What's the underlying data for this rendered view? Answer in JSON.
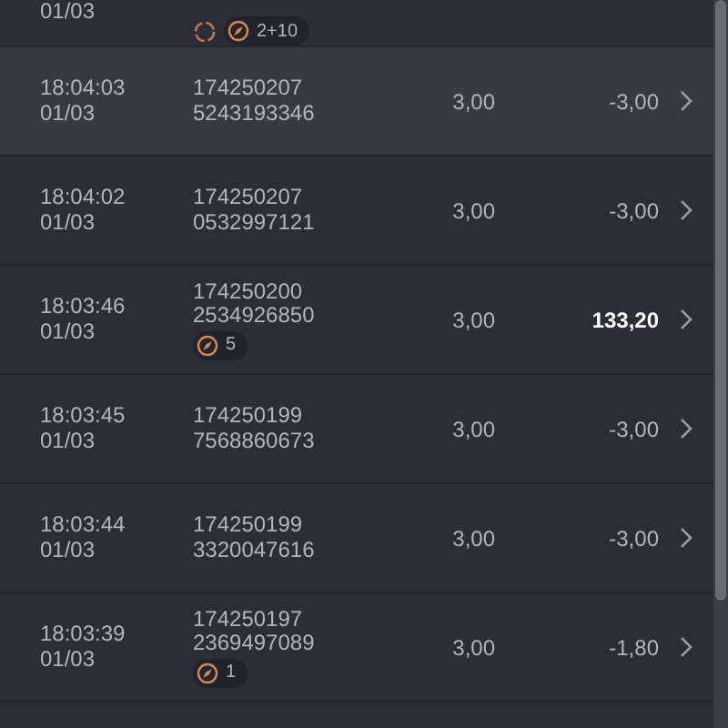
{
  "top_row": {
    "date": "01/03",
    "badges": [
      {
        "kind": "spin"
      },
      {
        "kind": "bonus",
        "text": "2+10"
      }
    ]
  },
  "rows": [
    {
      "time": "18:04:03",
      "date": "01/03",
      "id_1": "174250207",
      "id_2": "5243193346",
      "stake": "3,00",
      "result": "-3,00",
      "won": false,
      "selected": true,
      "badges": []
    },
    {
      "time": "18:04:02",
      "date": "01/03",
      "id_1": "174250207",
      "id_2": "0532997121",
      "stake": "3,00",
      "result": "-3,00",
      "won": false,
      "selected": false,
      "badges": []
    },
    {
      "time": "18:03:46",
      "date": "01/03",
      "id_1": "174250200",
      "id_2": "2534926850",
      "stake": "3,00",
      "result": "133,20",
      "won": true,
      "selected": false,
      "badges": [
        {
          "kind": "bonus",
          "text": "5"
        }
      ]
    },
    {
      "time": "18:03:45",
      "date": "01/03",
      "id_1": "174250199",
      "id_2": "7568860673",
      "stake": "3,00",
      "result": "-3,00",
      "won": false,
      "selected": false,
      "badges": []
    },
    {
      "time": "18:03:44",
      "date": "01/03",
      "id_1": "174250199",
      "id_2": "3320047616",
      "stake": "3,00",
      "result": "-3,00",
      "won": false,
      "selected": false,
      "badges": []
    },
    {
      "time": "18:03:39",
      "date": "01/03",
      "id_1": "174250197",
      "id_2": "2369497089",
      "stake": "3,00",
      "result": "-1,80",
      "won": false,
      "selected": false,
      "badges": [
        {
          "kind": "bonus",
          "text": "1"
        }
      ]
    }
  ]
}
